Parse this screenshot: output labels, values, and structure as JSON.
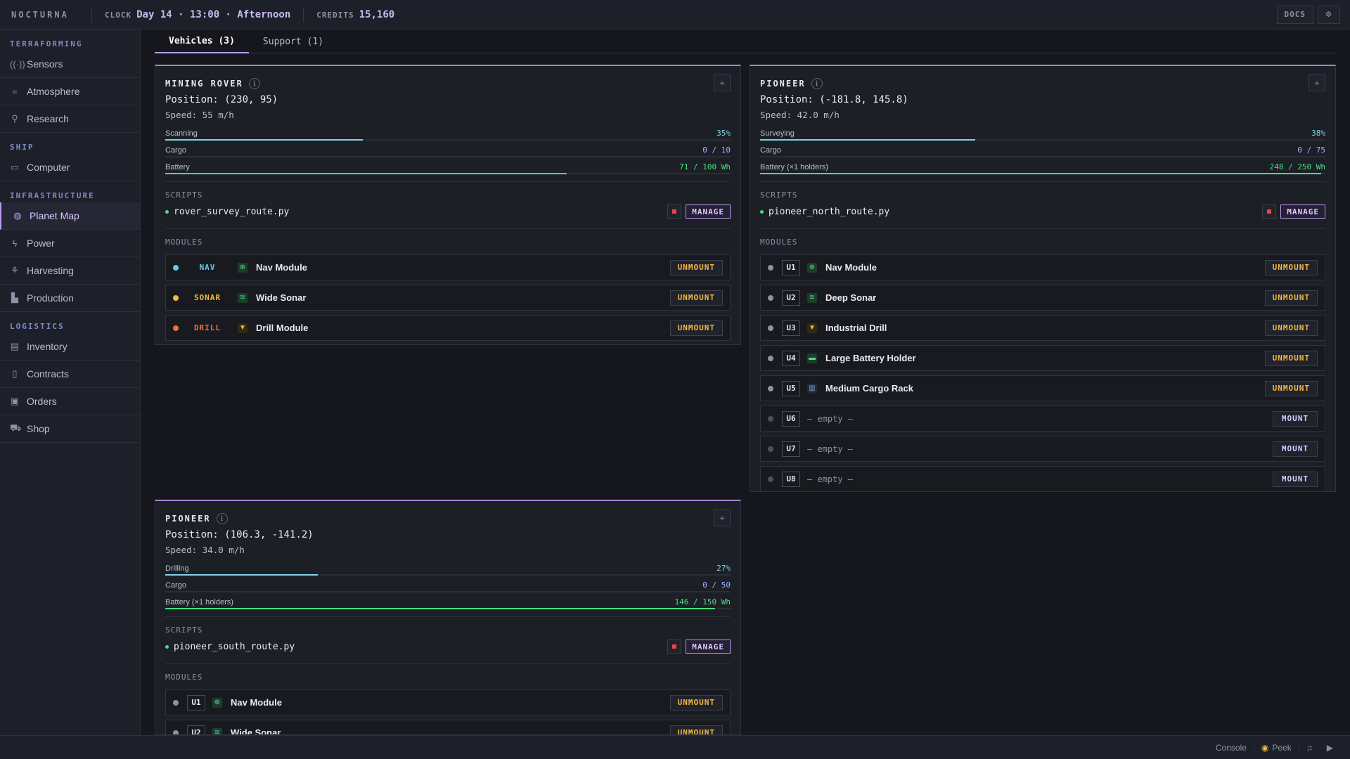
{
  "app": {
    "brand": "NOCTURNA",
    "clock_label": "CLOCK",
    "clock_value": "Day 14 · 13:00 · Afternoon",
    "credits_label": "CREDITS",
    "credits_value": "15,160",
    "docs_label": "DOCS",
    "settings_icon": "gear-icon"
  },
  "sidebar": {
    "sections": [
      {
        "title": "TERRAFORMING",
        "items": [
          {
            "label": "Sensors",
            "icon": "sensors-icon",
            "glyph": "((·))"
          },
          {
            "label": "Atmosphere",
            "icon": "atmosphere-icon",
            "glyph": "≈"
          },
          {
            "label": "Research",
            "icon": "research-icon",
            "glyph": "⚲"
          }
        ]
      },
      {
        "title": "SHIP",
        "items": [
          {
            "label": "Computer",
            "icon": "computer-icon",
            "glyph": "▭"
          }
        ]
      },
      {
        "title": "INFRASTRUCTURE",
        "items": [
          {
            "label": "Planet Map",
            "icon": "globe-icon",
            "glyph": "◍",
            "active": true
          },
          {
            "label": "Power",
            "icon": "lightning-icon",
            "glyph": "ϟ"
          },
          {
            "label": "Harvesting",
            "icon": "sprout-icon",
            "glyph": "⚘"
          },
          {
            "label": "Production",
            "icon": "factory-icon",
            "glyph": "▙"
          }
        ]
      },
      {
        "title": "LOGISTICS",
        "items": [
          {
            "label": "Inventory",
            "icon": "inventory-icon",
            "glyph": "▤"
          },
          {
            "label": "Contracts",
            "icon": "document-icon",
            "glyph": "▯"
          },
          {
            "label": "Orders",
            "icon": "orders-icon",
            "glyph": "▣"
          },
          {
            "label": "Shop",
            "icon": "cart-icon",
            "glyph": "⛟"
          }
        ]
      }
    ]
  },
  "tabs": [
    {
      "label": "Vehicles (3)",
      "active": true
    },
    {
      "label": "Support (1)",
      "active": false
    }
  ],
  "vehicles": [
    {
      "name": "MINING ROVER",
      "position": "Position: (230, 95)",
      "speed": "Speed: 55 m/h",
      "stats": [
        {
          "label": "Scanning",
          "value": "35%",
          "fraction": 0.35,
          "color": "#7dd3e8"
        },
        {
          "label": "Cargo",
          "value": "0 / 10",
          "fraction": 0,
          "color": "#9fb0ff"
        },
        {
          "label": "Battery",
          "value": "71 / 100 Wh",
          "fraction": 0.71,
          "color": "#4ade80"
        }
      ],
      "scripts_title": "SCRIPTS",
      "script": "rover_survey_route.py",
      "manage_label": "MANAGE",
      "modules_title": "MODULES",
      "modules": [
        {
          "tag": "NAV",
          "tag_color": "#5ed1e8",
          "dot_color": "#5ed1e8",
          "name": "Nav Module",
          "icon": "nav-module-icon",
          "action": "UNMOUNT"
        },
        {
          "tag": "SONAR",
          "tag_color": "#f5b942",
          "dot_color": "#f5b942",
          "name": "Wide Sonar",
          "icon": "sonar-module-icon",
          "action": "UNMOUNT"
        },
        {
          "tag": "DRILL",
          "tag_color": "#f0703c",
          "dot_color": "#f0703c",
          "name": "Drill Module",
          "icon": "drill-module-icon",
          "action": "UNMOUNT"
        }
      ]
    },
    {
      "name": "PIONEER",
      "position": "Position: (-181.8, 145.8)",
      "speed": "Speed: 42.0 m/h",
      "stats": [
        {
          "label": "Surveying",
          "value": "38%",
          "fraction": 0.38,
          "color": "#7dd3e8"
        },
        {
          "label": "Cargo",
          "value": "0 / 75",
          "fraction": 0,
          "color": "#9fb0ff"
        },
        {
          "label": "Battery (×1 holders)",
          "value": "248 / 250 Wh",
          "fraction": 0.992,
          "color": "#4ade80"
        }
      ],
      "scripts_title": "SCRIPTS",
      "script": "pioneer_north_route.py",
      "manage_label": "MANAGE",
      "modules_title": "MODULES",
      "modules": [
        {
          "slot": "U1",
          "name": "Nav Module",
          "icon": "nav-module-icon",
          "action": "UNMOUNT"
        },
        {
          "slot": "U2",
          "name": "Deep Sonar",
          "icon": "sonar-module-icon",
          "action": "UNMOUNT"
        },
        {
          "slot": "U3",
          "name": "Industrial Drill",
          "icon": "drill-module-icon",
          "action": "UNMOUNT"
        },
        {
          "slot": "U4",
          "name": "Large Battery Holder",
          "icon": "battery-module-icon",
          "action": "UNMOUNT"
        },
        {
          "slot": "U5",
          "name": "Medium Cargo Rack",
          "icon": "cargo-module-icon",
          "action": "UNMOUNT"
        },
        {
          "slot": "U6",
          "empty": "— empty —",
          "action": "MOUNT"
        },
        {
          "slot": "U7",
          "empty": "— empty —",
          "action": "MOUNT"
        },
        {
          "slot": "U8",
          "empty": "— empty —",
          "action": "MOUNT"
        }
      ]
    },
    {
      "name": "PIONEER",
      "position": "Position: (106.3, -141.2)",
      "speed": "Speed: 34.0 m/h",
      "stats": [
        {
          "label": "Drilling",
          "value": "27%",
          "fraction": 0.27,
          "color": "#7dd3e8"
        },
        {
          "label": "Cargo",
          "value": "0 / 50",
          "fraction": 0,
          "color": "#9fb0ff"
        },
        {
          "label": "Battery (×1 holders)",
          "value": "146 / 150 Wh",
          "fraction": 0.973,
          "color": "#4ade80"
        }
      ],
      "scripts_title": "SCRIPTS",
      "script": "pioneer_south_route.py",
      "manage_label": "MANAGE",
      "modules_title": "MODULES",
      "modules": [
        {
          "slot": "U1",
          "name": "Nav Module",
          "icon": "nav-module-icon",
          "action": "UNMOUNT"
        },
        {
          "slot": "U2",
          "name": "Wide Sonar",
          "icon": "sonar-module-icon",
          "action": "UNMOUNT"
        }
      ]
    }
  ],
  "statusbar": {
    "console_label": "Console",
    "peek_label": "Peek",
    "music_icon": "music-icon",
    "play_icon": "play-icon"
  }
}
